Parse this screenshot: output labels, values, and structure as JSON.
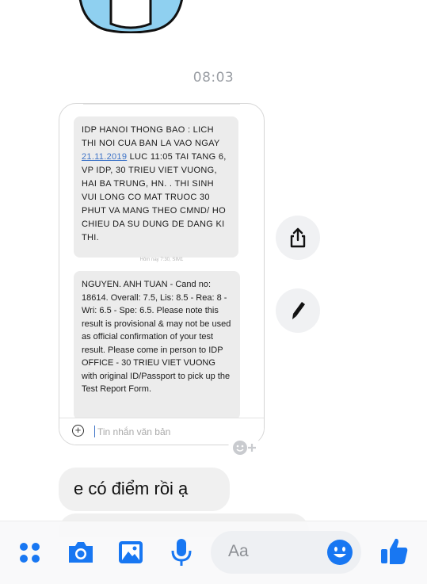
{
  "chat": {
    "time_divider": "08:03"
  },
  "screenshot": {
    "sms1_part1": "IDP HANOI THONG BAO : LICH THI NOI CUA BAN LA VAO NGAY ",
    "sms1_date": "21.11.2019",
    "sms1_part2": " LUC 11:05 TAI TANG 6, VP IDP, 30 TRIEU VIET VUONG, HAI BA TRUNG, HN. . THI SINH VUI LONG CO MAT TRUOC 30 PHUT VA MANG THEO CMND/ HO CHIEU DA SU DUNG DE DANG KI THI.",
    "timestamp": "Hôm nay 7:30, SIM1",
    "sms2": "NGUYEN. ANH TUAN - Cand no: 18614. Overall: 7.5, Lis: 8.5 - Rea: 8 - Wri: 6.5 - Spe: 6.5. Please note this result is provisional & may not be used as official confirmation of your test result. Please come in person to IDP OFFICE - 30 TRIEU VIET VUONG with original ID/Passport to pick up the Test Report Form.",
    "compose_placeholder": "Tin nhắn văn bản"
  },
  "message": {
    "text": "e có điểm rồi ạ"
  },
  "composer": {
    "placeholder": "Aa"
  },
  "icons": {
    "apps": "apps-icon",
    "camera": "camera-icon",
    "gallery": "gallery-icon",
    "mic": "microphone-icon",
    "emoji": "emoji-icon",
    "like": "thumbs-up-icon",
    "share": "share-icon",
    "pen": "pen-icon",
    "react": "add-reaction-icon"
  },
  "colors": {
    "accent": "#1877f2",
    "bubble": "#f0f0f0"
  }
}
